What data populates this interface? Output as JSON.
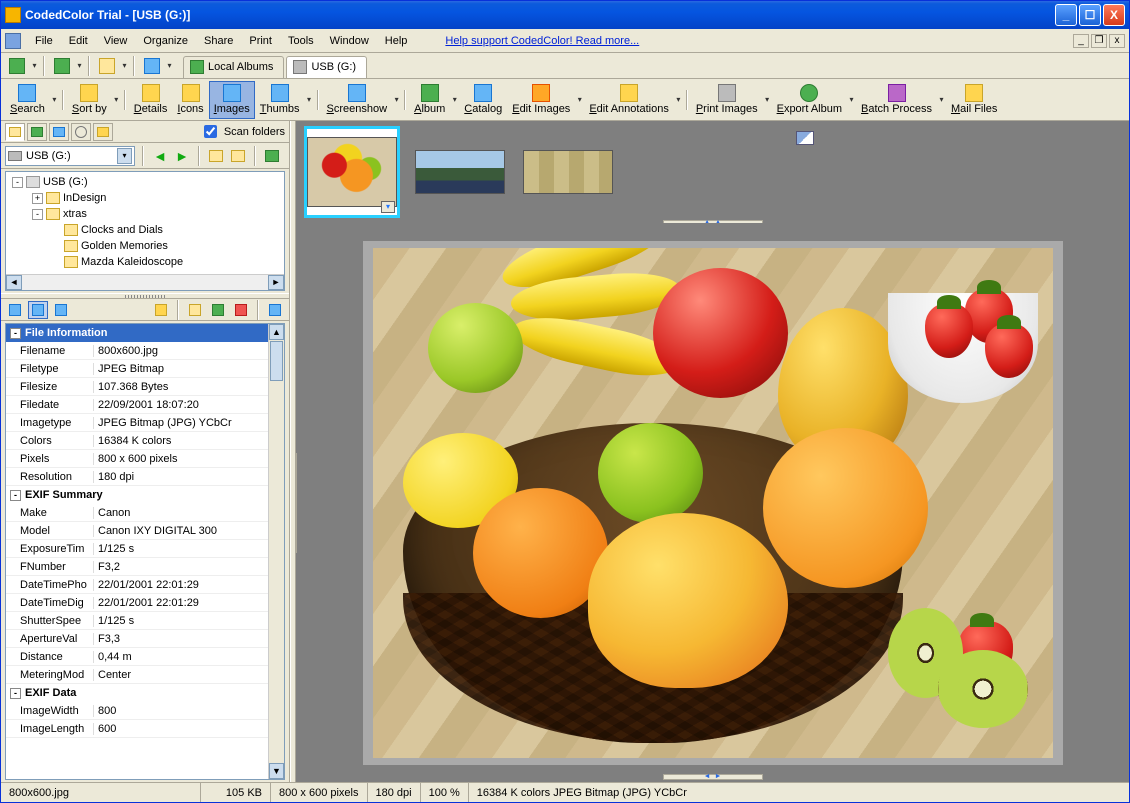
{
  "window": {
    "title": "CodedColor Trial - [USB (G:)]"
  },
  "menu": {
    "items": [
      "File",
      "Edit",
      "View",
      "Organize",
      "Share",
      "Print",
      "Tools",
      "Window",
      "Help"
    ],
    "support_link": "Help support CodedColor! Read more..."
  },
  "tabs": {
    "local": "Local Albums",
    "usb": "USB (G:)"
  },
  "bigtoolbar": {
    "search": "Search",
    "sortby": "Sort by",
    "details": "Details",
    "icons": "Icons",
    "images": "Images",
    "thumbs": "Thumbs",
    "screenshow": "Screenshow",
    "album": "Album",
    "catalog": "Catalog",
    "editimages": "Edit Images",
    "editannotations": "Edit Annotations",
    "printimages": "Print Images",
    "exportalbum": "Export Album",
    "batchprocess": "Batch Process",
    "mailfiles": "Mail Files"
  },
  "nav": {
    "scan_folders": "Scan folders",
    "drive": "USB (G:)",
    "tree": {
      "root": "USB (G:)",
      "children": [
        {
          "label": "InDesign",
          "exp": "+",
          "indent": 1
        },
        {
          "label": "xtras",
          "exp": "-",
          "indent": 1
        },
        {
          "label": "Clocks and Dials",
          "exp": "",
          "indent": 2
        },
        {
          "label": "Golden Memories",
          "exp": "",
          "indent": 2
        },
        {
          "label": "Mazda Kaleidoscope",
          "exp": "",
          "indent": 2
        }
      ]
    }
  },
  "file_info": {
    "header": "File Information",
    "rows": [
      {
        "k": "Filename",
        "v": "800x600.jpg"
      },
      {
        "k": "Filetype",
        "v": "JPEG Bitmap"
      },
      {
        "k": "Filesize",
        "v": "107.368 Bytes"
      },
      {
        "k": "Filedate",
        "v": "22/09/2001 18:07:20"
      },
      {
        "k": "Imagetype",
        "v": "JPEG Bitmap (JPG) YCbCr"
      },
      {
        "k": "Colors",
        "v": "16384 K colors"
      },
      {
        "k": "Pixels",
        "v": "800 x 600 pixels"
      },
      {
        "k": "Resolution",
        "v": "180 dpi"
      }
    ]
  },
  "exif_summary": {
    "header": "EXIF Summary",
    "rows": [
      {
        "k": "Make",
        "v": "Canon"
      },
      {
        "k": "Model",
        "v": "Canon IXY DIGITAL 300"
      },
      {
        "k": "ExposureTim",
        "v": "1/125 s"
      },
      {
        "k": "FNumber",
        "v": "F3,2"
      },
      {
        "k": "DateTimePho",
        "v": "22/01/2001 22:01:29"
      },
      {
        "k": "DateTimeDig",
        "v": "22/01/2001 22:01:29"
      },
      {
        "k": "ShutterSpee",
        "v": "1/125 s"
      },
      {
        "k": "ApertureVal",
        "v": "F3,3"
      },
      {
        "k": "Distance",
        "v": "0,44 m"
      },
      {
        "k": "MeteringMod",
        "v": "Center"
      }
    ]
  },
  "exif_data": {
    "header": "EXIF Data",
    "rows": [
      {
        "k": "ImageWidth",
        "v": "800"
      },
      {
        "k": "ImageLength",
        "v": "600"
      }
    ]
  },
  "status": {
    "filename": "800x600.jpg",
    "size": "105 KB",
    "pixels": "800 x 600 pixels",
    "dpi": "180 dpi",
    "zoom": "100 %",
    "desc": "16384 K colors JPEG Bitmap (JPG) YCbCr"
  }
}
